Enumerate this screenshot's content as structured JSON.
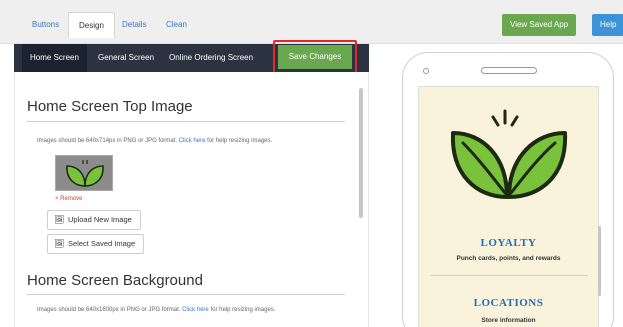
{
  "top_tabs": [
    "Buttons",
    "Design",
    "Details",
    "Clean"
  ],
  "top_actions": {
    "view_saved_app": "View Saved App",
    "help": "Help"
  },
  "sub_nav": {
    "items": [
      "Home Screen",
      "General Screen",
      "Online Ordering Screen"
    ],
    "save": "Save Changes"
  },
  "top_image": {
    "heading": "Home Screen Top Image",
    "help_prefix": "Images should be 640x714px in PNG or JPG format.",
    "help_link": "Click here",
    "help_suffix": "for help resizing images.",
    "remove": "Remove",
    "upload": "Upload New Image",
    "select": "Select Saved Image"
  },
  "background": {
    "heading": "Home Screen Background",
    "help_prefix": "Images should be 640x1600px in PNG or JPG format.",
    "help_link": "Click here",
    "help_suffix": "for help resizing images."
  },
  "preview": {
    "loyalty_title": "LOYALTY",
    "loyalty_sub": "Punch cards, points, and rewards",
    "locations_title": "LOCATIONS",
    "locations_sub": "Store information"
  },
  "colors": {
    "accent_green": "#6aa84f",
    "help_blue": "#3c93d8",
    "nav_dark": "#2b3340",
    "highlight_red": "#e3262b",
    "preview_title_blue": "#1e6fb8",
    "leaf_green": "#7bc23c"
  }
}
